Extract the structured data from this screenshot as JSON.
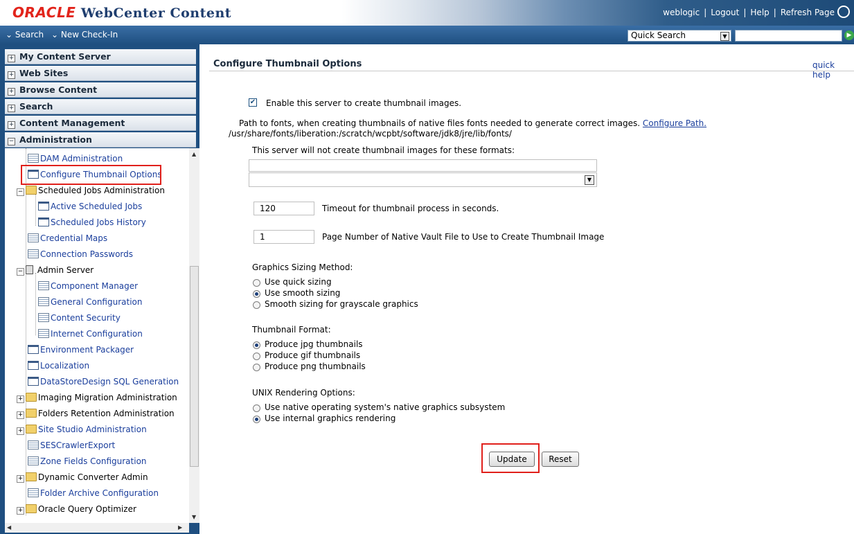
{
  "header": {
    "brand_oracle": "ORACLE",
    "brand_product": "WebCenter Content",
    "links": [
      "weblogic",
      "Logout",
      "Help",
      "Refresh Page"
    ],
    "separator": "|"
  },
  "nav": {
    "items": [
      "Search",
      "New Check-In"
    ],
    "quick_search_label": "Quick Search"
  },
  "sidebar": {
    "sections": [
      "My Content Server",
      "Web Sites",
      "Browse Content",
      "Search",
      "Content Management",
      "Administration"
    ],
    "tree": [
      {
        "label": "DAM Administration",
        "icon": "doc-icon",
        "link": true
      },
      {
        "label": "Configure Thumbnail Options",
        "icon": "window-icon",
        "link": true,
        "selected": true
      },
      {
        "label": "Scheduled Jobs Administration",
        "icon": "folder-icon",
        "link": false
      },
      {
        "label": "Active Scheduled Jobs",
        "icon": "window-icon",
        "link": true
      },
      {
        "label": "Scheduled Jobs History",
        "icon": "window-icon",
        "link": true
      },
      {
        "label": "Credential Maps",
        "icon": "doc-icon",
        "link": true
      },
      {
        "label": "Connection Passwords",
        "icon": "doc-icon",
        "link": true
      },
      {
        "label": "Admin Server",
        "icon": "server-icon",
        "link": false
      },
      {
        "label": "Component Manager",
        "icon": "doc-icon",
        "link": true
      },
      {
        "label": "General Configuration",
        "icon": "doc-icon",
        "link": true
      },
      {
        "label": "Content Security",
        "icon": "doc-icon",
        "link": true
      },
      {
        "label": "Internet Configuration",
        "icon": "doc-icon",
        "link": true
      },
      {
        "label": "Environment Packager",
        "icon": "window-icon",
        "link": true
      },
      {
        "label": "Localization",
        "icon": "window-icon",
        "link": true
      },
      {
        "label": "DataStoreDesign SQL Generation",
        "icon": "window-icon",
        "link": true
      },
      {
        "label": "Imaging Migration Administration",
        "icon": "folder-icon",
        "link": false
      },
      {
        "label": "Folders Retention Administration",
        "icon": "folder-icon",
        "link": false
      },
      {
        "label": "Site Studio Administration",
        "icon": "folder-icon",
        "link": true
      },
      {
        "label": "SESCrawlerExport",
        "icon": "doc-icon",
        "link": true
      },
      {
        "label": "Zone Fields Configuration",
        "icon": "doc-icon",
        "link": true
      },
      {
        "label": "Dynamic Converter Admin",
        "icon": "folder-icon",
        "link": false
      },
      {
        "label": "Folder Archive Configuration",
        "icon": "doc-icon",
        "link": true
      },
      {
        "label": "Oracle Query Optimizer",
        "icon": "folder-icon",
        "link": false
      }
    ]
  },
  "main": {
    "title": "Configure Thumbnail Options",
    "quick_help": "quick help",
    "enable_label": "Enable this server to create thumbnail images.",
    "enable_checked": true,
    "path_text": "Path to fonts, when creating thumbnails of native files fonts needed to generate correct images.",
    "configure_path": "Configure Path.",
    "font_path": "/usr/share/fonts/liberation:/scratch/wcpbt/software/jdk8/jre/lib/fonts/",
    "formats_label": "This server will not create thumbnail images for these formats:",
    "timeout_value": "120",
    "timeout_label": "Timeout for thumbnail process in seconds.",
    "page_number_value": "1",
    "page_number_label": "Page Number of Native Vault File to Use to Create Thumbnail Image",
    "sizing_title": "Graphics Sizing Method:",
    "sizing_options": [
      "Use quick sizing",
      "Use smooth sizing",
      "Smooth sizing for grayscale graphics"
    ],
    "sizing_selected": 1,
    "format_title": "Thumbnail Format:",
    "format_options": [
      "Produce jpg thumbnails",
      "Produce gif thumbnails",
      "Produce png thumbnails"
    ],
    "format_selected": 0,
    "unix_title": "UNIX Rendering Options:",
    "unix_options": [
      "Use native operating system's native graphics subsystem",
      "Use internal graphics rendering"
    ],
    "unix_selected": 1,
    "update_button": "Update",
    "reset_button": "Reset"
  },
  "colors": {
    "accent_red": "#e0201b",
    "nav_blue": "#1f4f80",
    "link_blue": "#1a3e9c"
  }
}
